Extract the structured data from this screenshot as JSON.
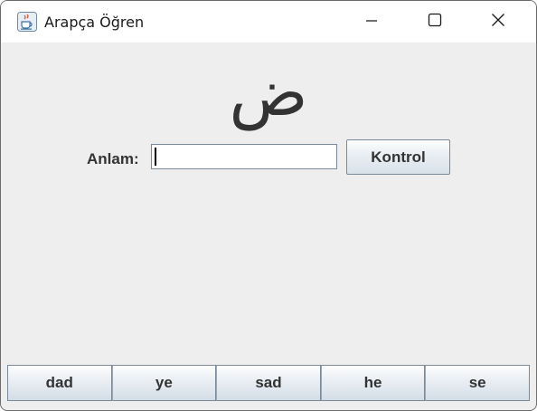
{
  "window": {
    "title": "Arapça Öğren",
    "icon": "java-cup-icon",
    "controls": {
      "minimize": "minimize-icon",
      "maximize": "maximize-icon",
      "close": "close-icon"
    }
  },
  "quiz": {
    "letter": "ض",
    "answer_label": "Anlam:",
    "answer_value": "",
    "check_button": "Kontrol"
  },
  "choices": [
    "dad",
    "ye",
    "sad",
    "he",
    "se"
  ],
  "colors": {
    "background": "#eeeeee",
    "text": "#333333",
    "border": "#7a8a99"
  }
}
